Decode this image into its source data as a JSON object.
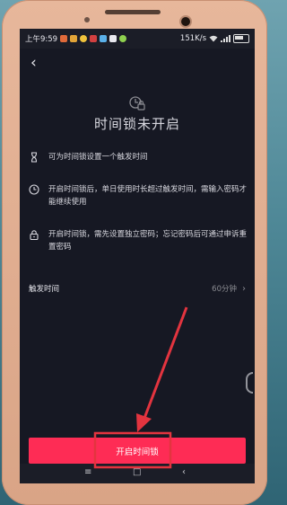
{
  "status_bar": {
    "time": "上午9:59",
    "network_speed": "151K/s"
  },
  "nav": {
    "back_glyph": "‹"
  },
  "page": {
    "title": "时间锁未开启"
  },
  "features": [
    {
      "icon": "hourglass-icon",
      "text": "可为时间锁设置一个触发时间"
    },
    {
      "icon": "clock-icon",
      "text": "开启时间锁后，单日使用时长超过触发时间，需输入密码才能继续使用"
    },
    {
      "icon": "lock-icon",
      "text": "开启时间锁，需先设置独立密码；忘记密码后可通过申诉重置密码"
    }
  ],
  "trigger_row": {
    "label": "触发时间",
    "value": "60分钟"
  },
  "primary_button": {
    "label": "开启时间锁"
  },
  "colors": {
    "screen_bg": "#161823",
    "accent": "#fe2c55",
    "annotation_red": "#e3343f",
    "phone_body": "#e0ad90",
    "secondary_text": "#8a8b91"
  }
}
